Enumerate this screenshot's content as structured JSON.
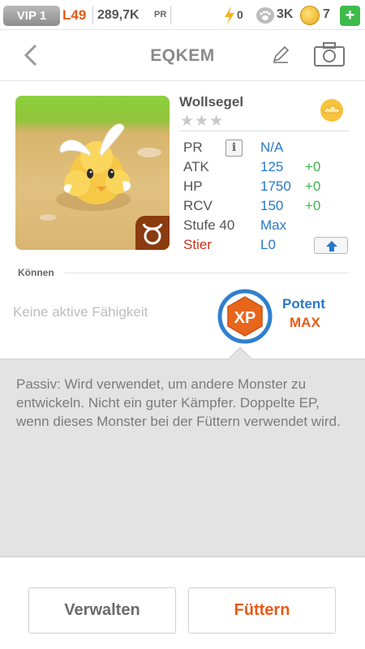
{
  "status_bar": {
    "vip": "VIP 1",
    "level": "L49",
    "power_value": "289,7K",
    "power_unit": "PR",
    "energy": "0",
    "paws": "3K",
    "coins": "7",
    "add": "+"
  },
  "header": {
    "title": "EQKEM"
  },
  "monster": {
    "name": "Wollsegel",
    "stars": "★★★",
    "stars_count": 0,
    "stats": {
      "pr_label": "PR",
      "pr_value": "N/A",
      "atk_label": "ATK",
      "atk_value": "125",
      "atk_plus": "+0",
      "hp_label": "HP",
      "hp_value": "1750",
      "hp_plus": "+0",
      "rcv_label": "RCV",
      "rcv_value": "150",
      "rcv_plus": "+0",
      "level_label": "Stufe 40",
      "level_value": "Max",
      "sign_label": "Stier",
      "sign_value": "L0"
    }
  },
  "skills": {
    "label": "Können",
    "no_active": "Keine aktive Fähigkeit",
    "badge": "XP",
    "passive_name": "Potent",
    "passive_level": "MAX",
    "passive_text": "Passiv: Wird verwendet, um andere Monster zu entwickeln. Nicht ein guter Kämpfer. Doppelte EP, wenn dieses Monster bei der Füttern verwendet wird."
  },
  "footer": {
    "manage": "Verwalten",
    "feed": "Füttern"
  },
  "colors": {
    "accent_orange": "#e85b16",
    "stat_blue": "#2778c9",
    "plus_green": "#3db54a",
    "sign_red": "#c6331a"
  }
}
